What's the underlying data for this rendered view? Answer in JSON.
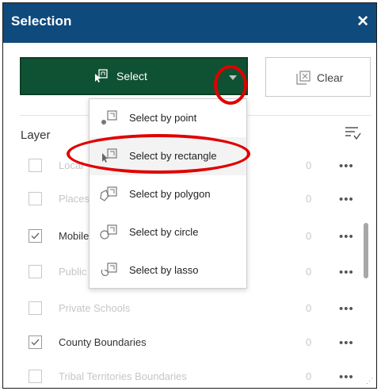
{
  "panel": {
    "title": "Selection",
    "close_icon": "close-icon",
    "select_button": {
      "label": "Select",
      "icon": "select-rectangle-icon",
      "caret_icon": "chevron-down-icon"
    },
    "clear_button": {
      "label": "Clear",
      "icon": "clear-selection-icon"
    },
    "layer_header": "Layer",
    "sort_icon": "sort-filter-icon"
  },
  "dropdown": {
    "items": [
      {
        "label": "Select by point",
        "icon": "point-select-icon"
      },
      {
        "label": "Select by rectangle",
        "icon": "rectangle-select-icon",
        "highlighted": true
      },
      {
        "label": "Select by polygon",
        "icon": "polygon-select-icon"
      },
      {
        "label": "Select by circle",
        "icon": "circle-select-icon"
      },
      {
        "label": "Select by lasso",
        "icon": "lasso-select-icon"
      }
    ]
  },
  "layers": [
    {
      "name": "Local",
      "checked": false,
      "count": "0"
    },
    {
      "name": "Places",
      "checked": false,
      "count": "0"
    },
    {
      "name": "Mobile",
      "checked": true,
      "count": "0"
    },
    {
      "name": "Public",
      "checked": false,
      "count": "0"
    },
    {
      "name": "Private Schools",
      "checked": false,
      "count": "0"
    },
    {
      "name": "County Boundaries",
      "checked": true,
      "count": "0"
    },
    {
      "name": "Tribal Territories Boundaries",
      "checked": false,
      "count": "0"
    }
  ],
  "row_menu_label": "•••",
  "colors": {
    "header_bg": "#0f4a7d",
    "select_bg": "#0f5233",
    "annotation_red": "#e00000"
  }
}
